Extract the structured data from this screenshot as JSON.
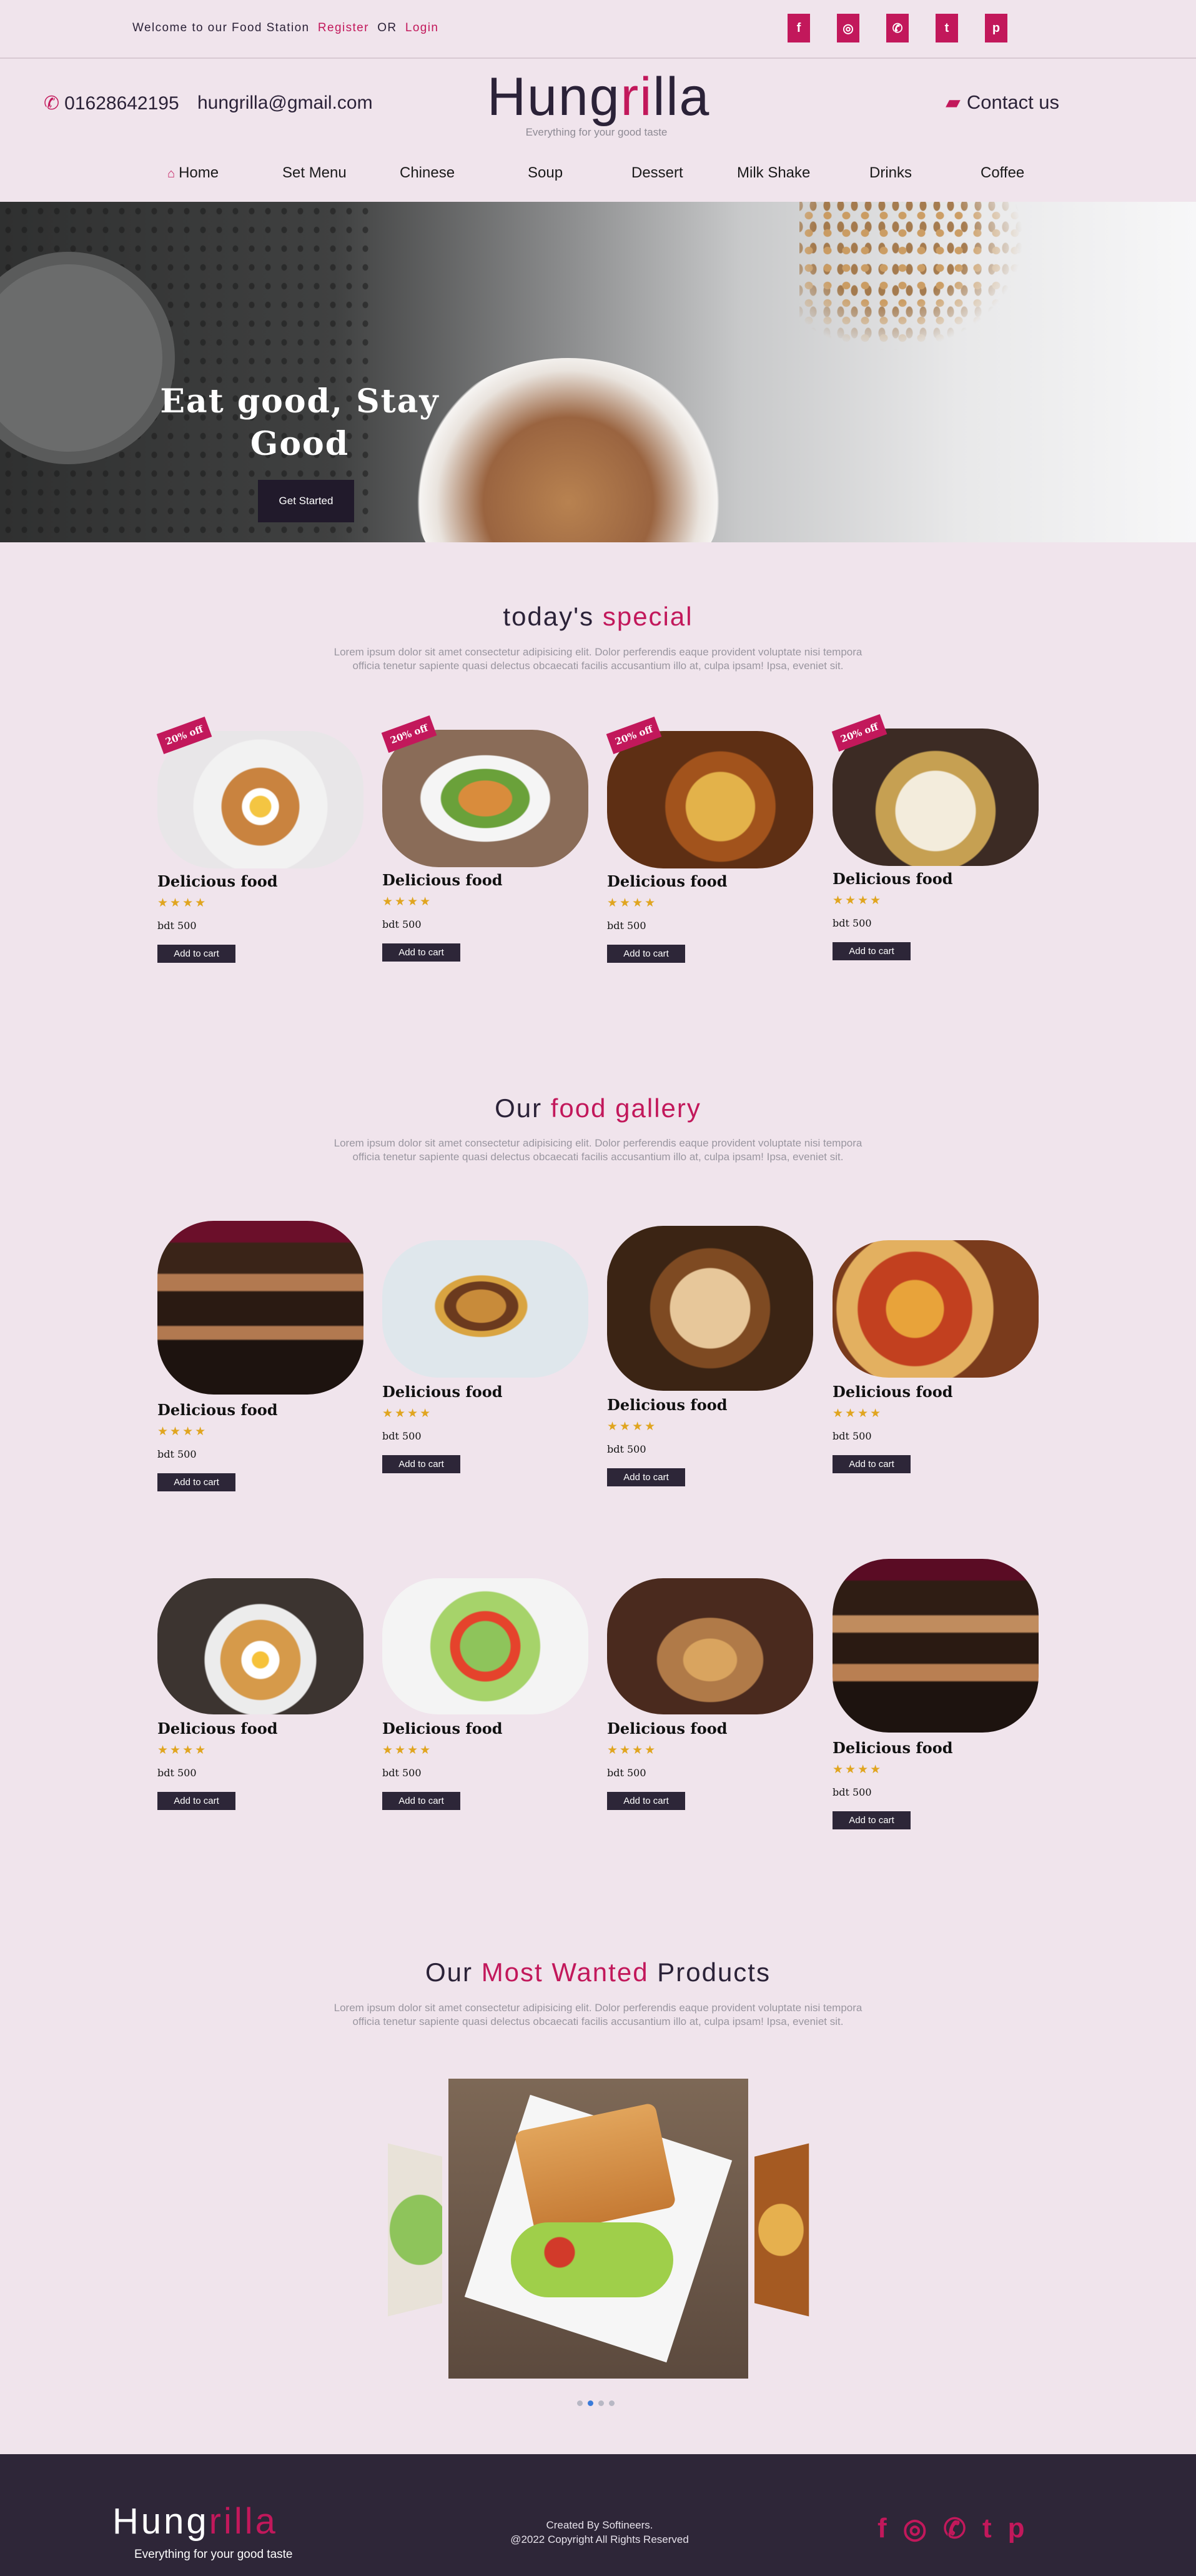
{
  "topbar": {
    "welcome": "Welcome to our Food Station",
    "register": "Register",
    "or": "OR",
    "login": "Login",
    "social": [
      "f",
      "◎",
      "✆",
      "t",
      "p"
    ]
  },
  "header": {
    "phone": "01628642195",
    "email": "hungrilla@gmail.com",
    "logo_a": "Hung",
    "logo_b": "ri",
    "logo_c": "lla",
    "tagline": "Everything for your good taste",
    "contact": "Contact us"
  },
  "nav": [
    "Home",
    "Set Menu",
    "Chinese",
    "Soup",
    "Dessert",
    "Milk Shake",
    "Drinks",
    "Coffee"
  ],
  "hero": {
    "title_line1": "Eat good, Stay",
    "title_line2": "Good",
    "button": "Get Started"
  },
  "special": {
    "title_a": "today's",
    "title_b": "special",
    "lorem1": "Lorem ipsum dolor sit amet consectetur adipisicing elit. Dolor perferendis eaque provident voluptate nisi tempora",
    "lorem2": "officia tenetur sapiente quasi delectus obcaecati facilis accusantium illo at, culpa ipsam! Ipsa, eveniet sit.",
    "badge": "20% off",
    "items": [
      {
        "name": "Delicious food",
        "price": "bdt 500",
        "button": "Add to cart"
      },
      {
        "name": "Delicious food",
        "price": "bdt 500",
        "button": "Add to cart"
      },
      {
        "name": "Delicious food",
        "price": "bdt 500",
        "button": "Add to cart"
      },
      {
        "name": "Delicious food",
        "price": "bdt 500",
        "button": "Add to cart"
      }
    ]
  },
  "gallery": {
    "title_a": "Our",
    "title_b": "food gallery",
    "lorem1": "Lorem ipsum dolor sit amet consectetur adipisicing elit. Dolor perferendis eaque provident voluptate nisi tempora",
    "lorem2": "officia tenetur sapiente quasi delectus obcaecati facilis accusantium illo at, culpa ipsam! Ipsa, eveniet sit.",
    "items": [
      {
        "name": "Delicious food",
        "price": "bdt 500",
        "button": "Add to cart"
      },
      {
        "name": "Delicious food",
        "price": "bdt 500",
        "button": "Add to cart"
      },
      {
        "name": "Delicious food",
        "price": "bdt 500",
        "button": "Add to cart"
      },
      {
        "name": "Delicious food",
        "price": "bdt 500",
        "button": "Add to cart"
      },
      {
        "name": "Delicious food",
        "price": "bdt 500",
        "button": "Add to cart"
      },
      {
        "name": "Delicious food",
        "price": "bdt 500",
        "button": "Add to cart"
      },
      {
        "name": "Delicious food",
        "price": "bdt 500",
        "button": "Add to cart"
      },
      {
        "name": "Delicious food",
        "price": "bdt 500",
        "button": "Add to cart"
      }
    ]
  },
  "wanted": {
    "title_a": "Our",
    "title_b": "Most Wanted",
    "title_c": "Products",
    "lorem1": "Lorem ipsum dolor sit amet consectetur adipisicing elit. Dolor perferendis eaque provident voluptate nisi tempora",
    "lorem2": "officia tenetur sapiente quasi delectus obcaecati facilis accusantium illo at, culpa ipsam! Ipsa, eveniet sit.",
    "carousel_active_index": 2,
    "carousel_count": 4
  },
  "footer": {
    "logo_a": "Hung",
    "logo_b": "rilla",
    "tagline": "Everything for your good taste",
    "credit1": "Created By Softineers.",
    "credit2": "@2022 Copyright All Rights Reserved",
    "social": [
      "f",
      "◎",
      "✆",
      "t",
      "p"
    ]
  },
  "colors": {
    "accent": "#c2185b",
    "dark": "#2e2638",
    "background": "#f0e4ec",
    "stars": "#e0a51f"
  },
  "ratings": {
    "stars_shown": 4
  }
}
